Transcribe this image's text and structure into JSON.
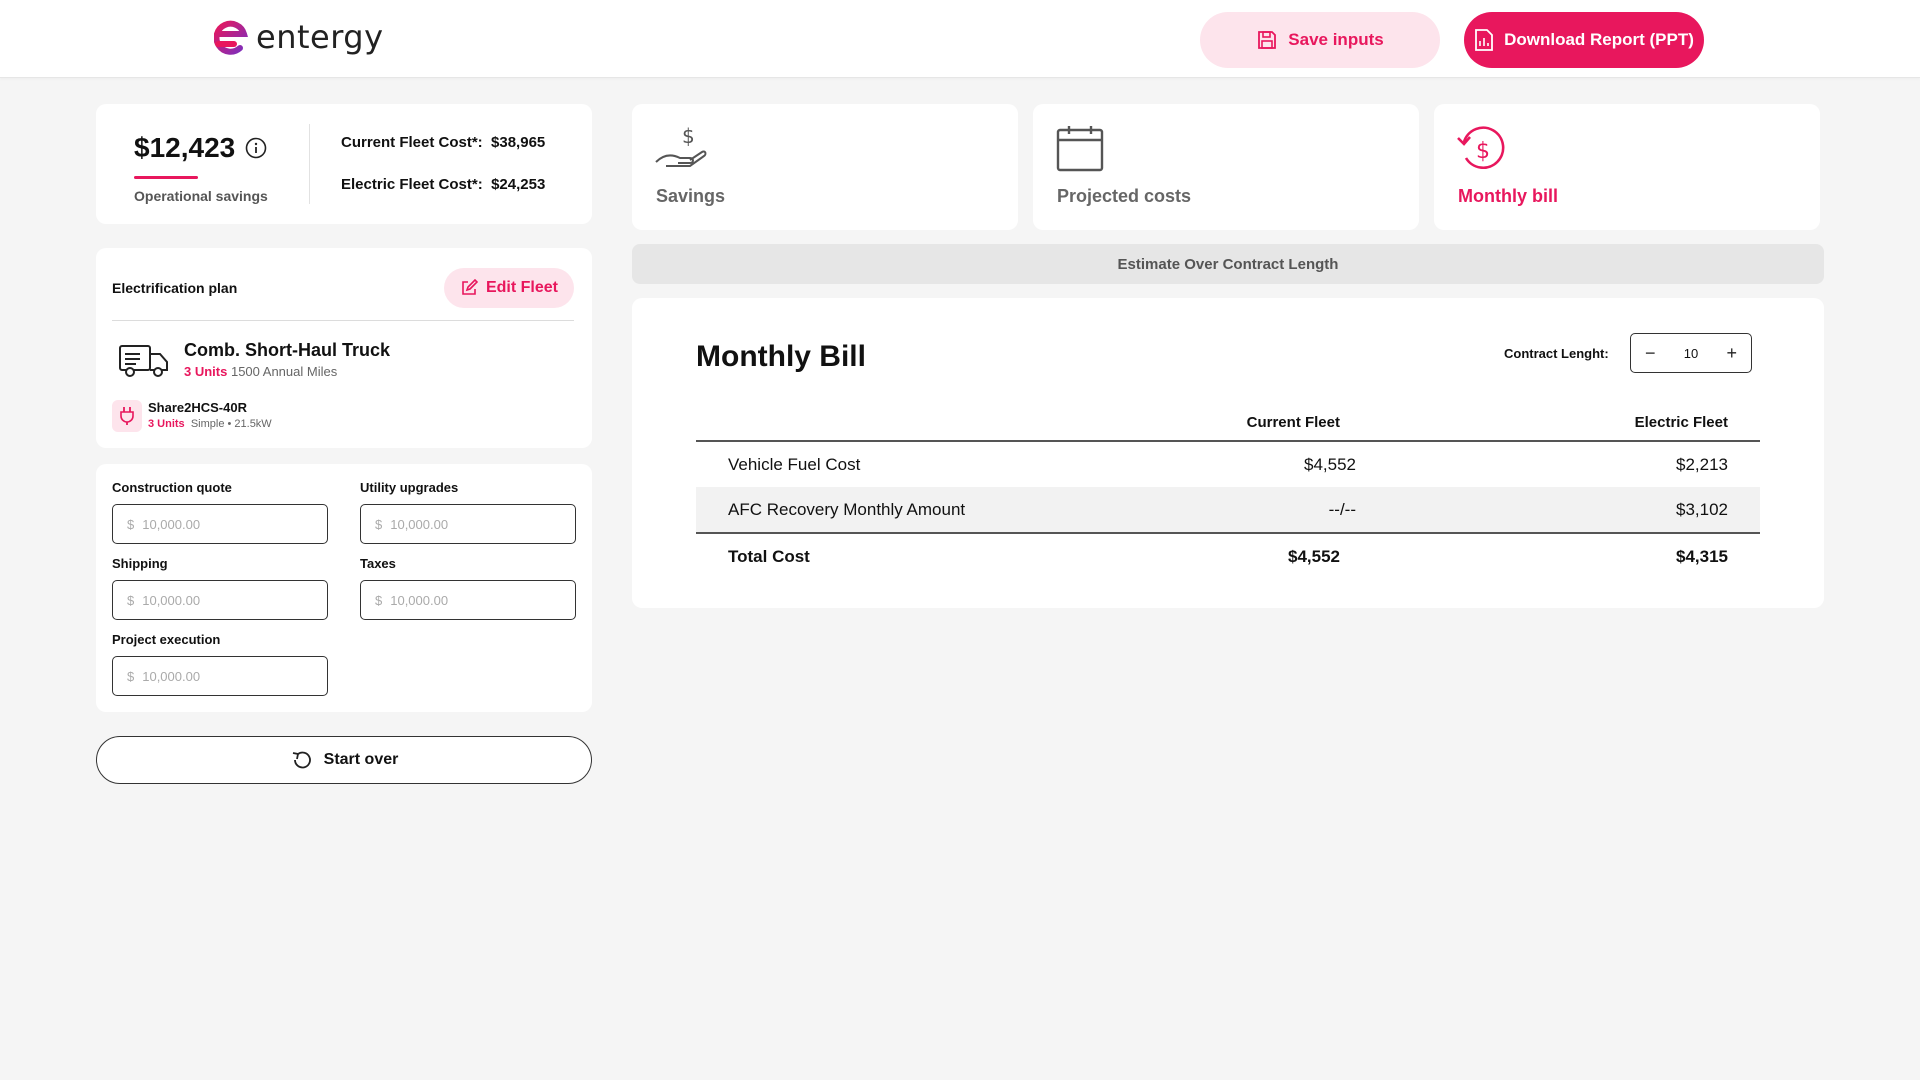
{
  "header": {
    "logo_text": "entergy",
    "save_label": "Save inputs",
    "download_label": "Download Report (PPT)"
  },
  "summary": {
    "savings_amount": "$12,423",
    "savings_label": "Operational savings",
    "current_label": "Current Fleet Cost*:",
    "current_value": "$38,965",
    "electric_label": "Electric Fleet Cost*:",
    "electric_value": "$24,253"
  },
  "plan": {
    "title": "Electrification plan",
    "edit_label": "Edit Fleet",
    "vehicle": {
      "name": "Comb. Short-Haul Truck",
      "units": "3 Units",
      "miles": "1500 Annual Miles"
    },
    "charger": {
      "name": "Share2HCS-40R",
      "units": "3 Units",
      "details": "Simple • 21.5kW"
    }
  },
  "inputs": {
    "construction": {
      "label": "Construction quote",
      "prefix": "$",
      "placeholder": "10,000.00"
    },
    "utility": {
      "label": "Utility upgrades",
      "prefix": "$",
      "placeholder": "10,000.00"
    },
    "shipping": {
      "label": "Shipping",
      "prefix": "$",
      "placeholder": "10,000.00"
    },
    "taxes": {
      "label": "Taxes",
      "prefix": "$",
      "placeholder": "10,000.00"
    },
    "project": {
      "label": "Project execution",
      "prefix": "$",
      "placeholder": "10,000.00"
    }
  },
  "start_over_label": "Start over",
  "tabs": [
    {
      "label": "Savings",
      "icon": "hand-dollar-icon",
      "active": false
    },
    {
      "label": "Projected costs",
      "icon": "calendar-icon",
      "active": false
    },
    {
      "label": "Monthly bill",
      "icon": "refresh-dollar-icon",
      "active": true
    }
  ],
  "estimate_label": "Estimate Over Contract Length",
  "bill": {
    "title": "Monthly Bill",
    "contract_label": "Contract Lenght:",
    "contract_value": "10",
    "minus": "−",
    "plus": "+",
    "columns": [
      "Current Fleet",
      "Electric Fleet"
    ],
    "rows": [
      {
        "name": "Vehicle Fuel Cost",
        "current": "$4,552",
        "electric": "$2,213"
      },
      {
        "name": "AFC Recovery Monthly Amount",
        "current": "--/--",
        "electric": "$3,102"
      }
    ],
    "total": {
      "name": "Total Cost",
      "current": "$4,552",
      "electric": "$4,315"
    }
  },
  "colors": {
    "accent": "#e8175d",
    "accent_light": "#fde4ec"
  }
}
